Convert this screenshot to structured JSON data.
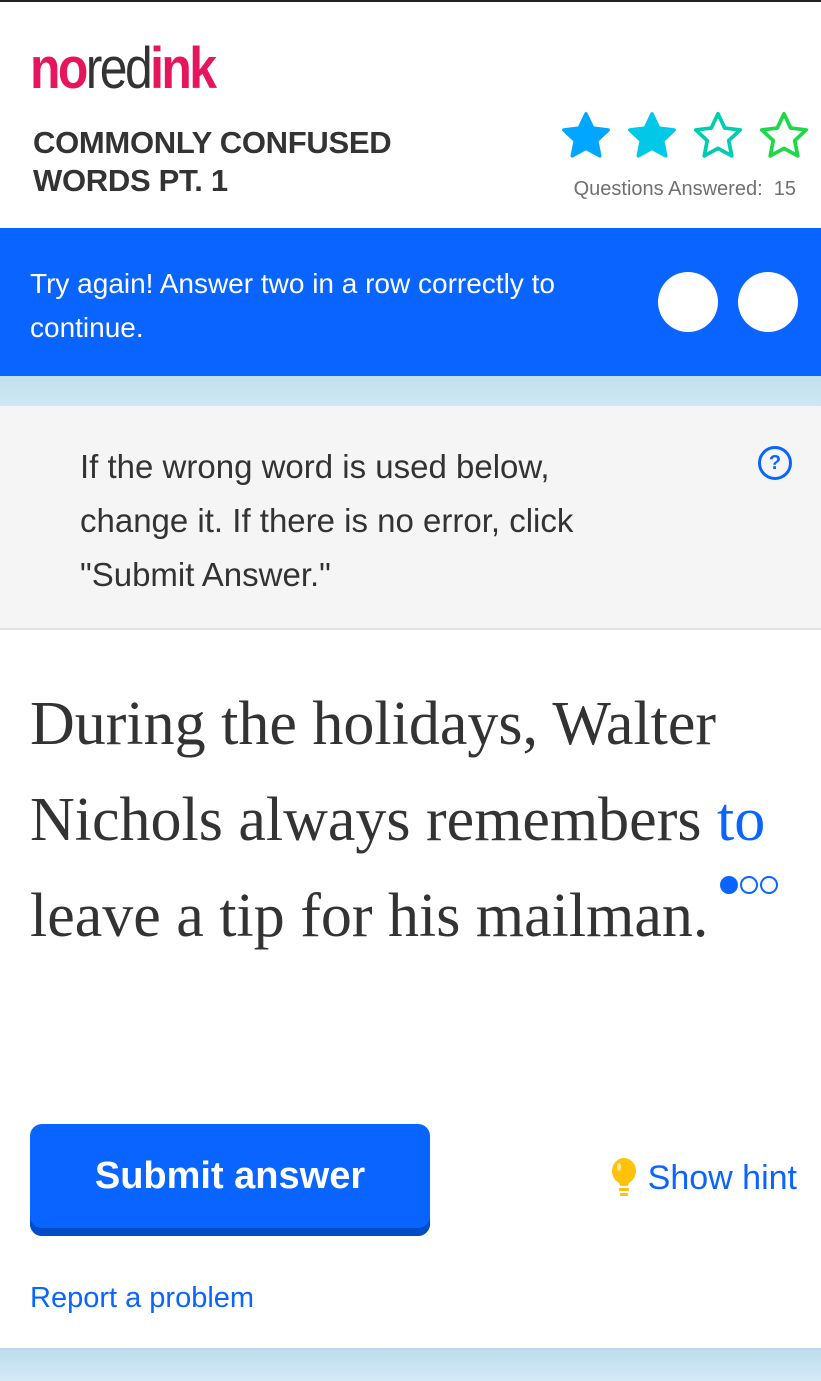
{
  "header": {
    "logo": {
      "part1": "no",
      "part2": "red",
      "part3": "ink"
    },
    "title": "COMMONLY CONFUSED WORDS PT. 1",
    "stars": [
      {
        "state": "filled",
        "color": "#00a6ff"
      },
      {
        "state": "filled",
        "color": "#00c8e6"
      },
      {
        "state": "empty",
        "color": "#00ccb0"
      },
      {
        "state": "empty",
        "color": "#1ed84a"
      }
    ],
    "questions_answered_label": "Questions Answered:",
    "questions_answered_value": "15"
  },
  "banner": {
    "message": "Try again! Answer two in a row correctly to continue.",
    "streak_total": 2,
    "streak_correct": 0
  },
  "instructions": {
    "text": "If the wrong word is used below, change it. If there is no error, click \"Submit Answer.\"",
    "help_icon": "?"
  },
  "question": {
    "before": "During the holidays, Walter Nichols always remembers ",
    "target_word": "to",
    "after": " leave a tip for his mailman.",
    "attempts": {
      "used": 1,
      "total": 3
    }
  },
  "actions": {
    "submit_label": "Submit answer",
    "hint_label": "Show hint",
    "report_label": "Report a problem"
  },
  "colors": {
    "brand_pink": "#e5165e",
    "primary_blue": "#0a64ff",
    "hint_yellow": "#ffc20a"
  }
}
